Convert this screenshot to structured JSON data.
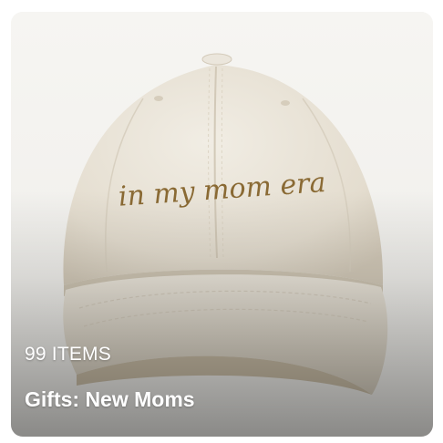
{
  "card": {
    "item_count": "99 ITEMS",
    "title": "Gifts: New Moms",
    "image": {
      "embroidered_text": "in my mom era"
    }
  },
  "colors": {
    "cap": "#e7e2d6",
    "thread": "#8a6a34",
    "text": "#ffffff"
  }
}
